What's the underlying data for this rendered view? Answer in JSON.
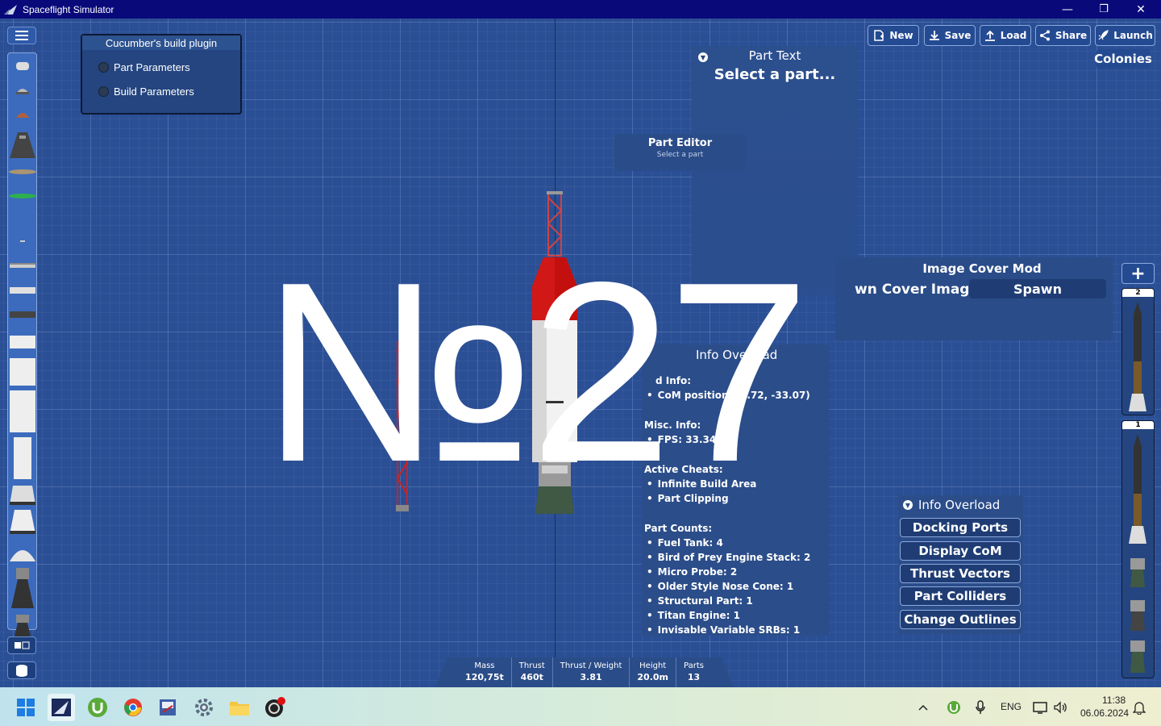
{
  "window": {
    "title": "Spaceflight Simulator",
    "minimize_glyph": "—",
    "maximize_glyph": "❐",
    "close_glyph": "✕"
  },
  "plugin_panel": {
    "title": "Cucumber's build plugin",
    "options": [
      "Part Parameters",
      "Build Parameters"
    ]
  },
  "part_text": {
    "title": "Part Text",
    "subtitle": "Select a part..."
  },
  "part_editor": {
    "title": "Part Editor",
    "subtitle": "Select a part"
  },
  "toolbar": {
    "new_label": "New",
    "save_label": "Save",
    "load_label": "Load",
    "share_label": "Share",
    "launch_label": "Launch",
    "colonies_label": "Colonies"
  },
  "cover_mod": {
    "title": "Image Cover Mod",
    "label": "wn Cover Image",
    "spawn_label": "Spawn"
  },
  "info_panel": {
    "title": "Info Overload",
    "section_partial": "d Info:",
    "com_position": "CoM position: (9.72, -33.07)",
    "misc_heading": "Misc. Info:",
    "fps": "FPS: 33.34",
    "cheats_heading": "Active Cheats:",
    "cheats": [
      "Infinite Build Area",
      "Part Clipping"
    ],
    "counts_heading": "Part Counts:",
    "counts": [
      "Fuel Tank: 4",
      "Bird of Prey Engine Stack: 2",
      "Micro Probe: 2",
      "Older Style Nose Cone: 1",
      "Structural Part: 1",
      "Titan Engine: 1",
      "Invisable Variable SRBs: 1"
    ]
  },
  "info_options": {
    "title": "Info Overload",
    "buttons": [
      "Docking Ports",
      "Display CoM",
      "Thrust Vectors",
      "Part Colliders",
      "Change Outlines"
    ]
  },
  "stages": {
    "add_label": "+",
    "items": [
      {
        "number": "2"
      },
      {
        "number": "1"
      }
    ]
  },
  "stats": {
    "mass_label": "Mass",
    "mass_value": "120,75t",
    "thrust_label": "Thrust",
    "thrust_value": "460t",
    "tw_label": "Thrust / Weight",
    "tw_value": "3.81",
    "height_label": "Height",
    "height_value": "20.0m",
    "parts_label": "Parts",
    "parts_value": "13"
  },
  "overlay_text": "№27",
  "taskbar": {
    "language": "ENG",
    "time": "11:38",
    "date": "06.06.2024"
  },
  "colors": {
    "titlebar": "#09097a",
    "panel": "#2b4d8a",
    "workspace": "#2b4f94",
    "rocket_red": "#c40f0f"
  }
}
